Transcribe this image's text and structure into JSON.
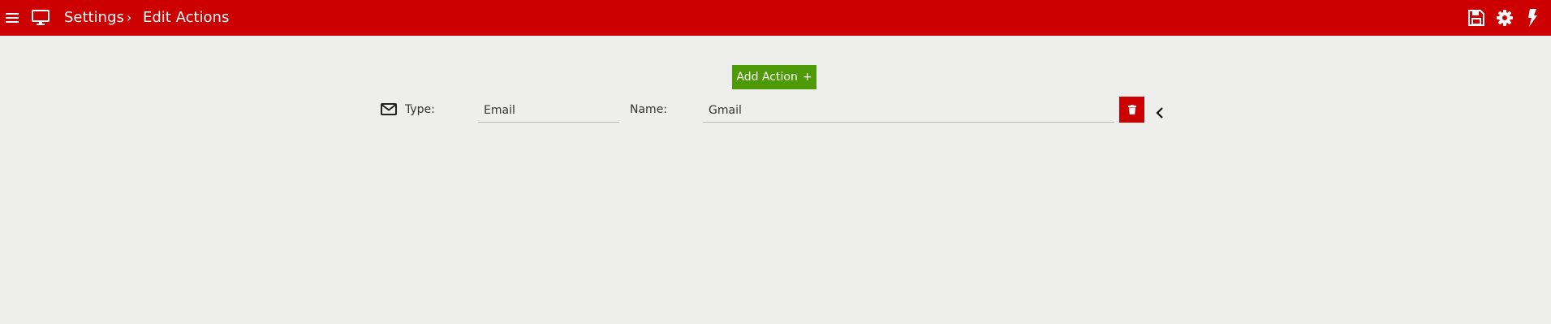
{
  "header": {
    "breadcrumb": {
      "root": "Settings",
      "separator": "›",
      "current": "Edit Actions"
    },
    "icons": {
      "menu": "menu-icon",
      "monitor": "monitor-icon",
      "save": "save-icon",
      "settings": "gear-icon",
      "flash": "flash-icon"
    },
    "background_color": "#cc0000"
  },
  "toolbar": {
    "add_action_label": "Add Action",
    "add_action_icon": "+",
    "add_action_color": "#4e9a06"
  },
  "actions": [
    {
      "icon": "mail-icon",
      "type_label": "Type:",
      "type_value": "Email",
      "name_label": "Name:",
      "name_value": "Gmail",
      "delete_icon": "trash-icon",
      "expand_icon": "chevron-left-icon"
    }
  ]
}
